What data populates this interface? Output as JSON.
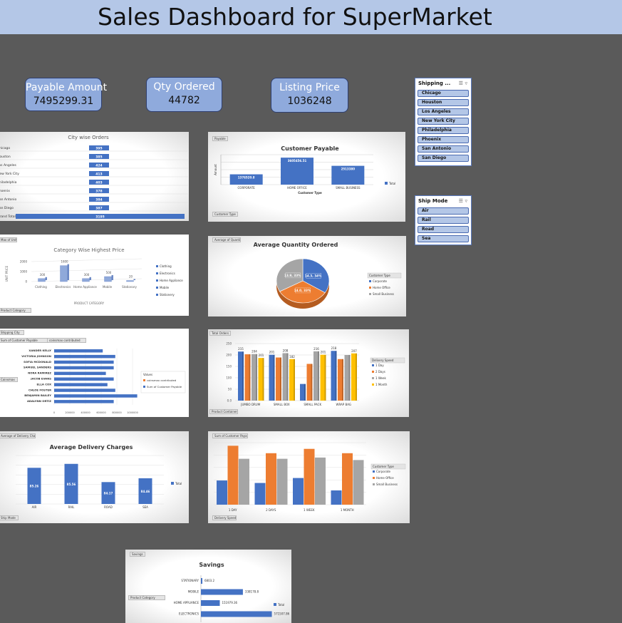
{
  "header": {
    "title": "Sales Dashboard for SuperMarket"
  },
  "kpis": [
    {
      "label": "Payable Amount",
      "value": "7495299.31"
    },
    {
      "label": "Qty Ordered",
      "value": "44782"
    },
    {
      "label": "Listing Price",
      "value": "1036248"
    }
  ],
  "slicers": [
    {
      "title": "Shipping ...",
      "items": [
        "Chicago",
        "Houston",
        "Los Angeles",
        "New York City",
        "Philadelphia",
        "Phoenix",
        "San Antonio",
        "San Diego"
      ]
    },
    {
      "title": "Ship Mode",
      "items": [
        "Air",
        "Rail",
        "Road",
        "Sea"
      ]
    }
  ],
  "colors": {
    "blue": "#4472c4",
    "orange": "#ed7d31",
    "gray": "#a5a5a5",
    "yellow": "#ffc000",
    "title_bar": "#b4c7e7",
    "kpi": "#8faadc",
    "background": "#5a5a5a"
  },
  "chart_data": [
    {
      "id": "city_orders",
      "type": "table",
      "title": "City wise Orders",
      "rows": [
        {
          "label": "Chicago",
          "value": 395
        },
        {
          "label": "Houston",
          "value": 385
        },
        {
          "label": "Los Angeles",
          "value": 424
        },
        {
          "label": "New York City",
          "value": 413
        },
        {
          "label": "Philadelphia",
          "value": 403
        },
        {
          "label": "Phoenix",
          "value": 378
        },
        {
          "label": "San Antonio",
          "value": 384
        },
        {
          "label": "San Diego",
          "value": 387
        },
        {
          "label": "Grand Total",
          "value": 3195
        }
      ]
    },
    {
      "id": "customer_payable",
      "type": "bar",
      "title": "Customer Payable",
      "categories": [
        "CORPORATE",
        "HOME OFFICE",
        "SMALL BUSINESS"
      ],
      "values": [
        1376520.8,
        3605456.51,
        2513380
      ],
      "value_labels": [
        "1376520.8",
        "3605456.51",
        "2513380"
      ],
      "xlabel": "Customer Type",
      "ylabel": "Amount",
      "ylim": [
        0,
        4000000
      ],
      "legend": "Total",
      "filter_top": "Payable",
      "filter_bottom": "Customer Type"
    },
    {
      "id": "category_price",
      "type": "bar",
      "title": "Category Wise Highest Price",
      "categories": [
        "Clothing",
        "Electronics",
        "Home Appliance",
        "Mobile",
        "Stationary"
      ],
      "values": [
        300,
        1600,
        300,
        500,
        20
      ],
      "value_labels": [
        "300",
        "1600",
        "300",
        "500",
        "20"
      ],
      "yticks": [
        "0",
        "1000",
        "2000"
      ],
      "ylim": [
        0,
        2000
      ],
      "xlabel": "PRODUCT CATEGORY",
      "ylabel": "UNIT PRICE",
      "legend_items": [
        "Clothing",
        "Electronics",
        "Home Appliance",
        "Mobile",
        "Stationery"
      ],
      "filter_top": "Max of Unit Price",
      "filter_bottom": "Product Category"
    },
    {
      "id": "avg_qty",
      "type": "pie",
      "title": "Average Quantity Ordered",
      "slices": [
        {
          "name": "Corporate",
          "value": 34,
          "label": "14.3, 34%"
        },
        {
          "name": "Home Office",
          "value": 33,
          "label": "14.0, 33%"
        },
        {
          "name": "Small Business",
          "value": 33,
          "label": "13.9, 33%"
        }
      ],
      "legend_title": "Customer Type",
      "filter_top": "Average of Quantity"
    },
    {
      "id": "customer_payable_hbar",
      "type": "bar",
      "title": "",
      "categories": [
        "XANDER KELLY",
        "VICTORIA JOHNSON",
        "SOFIA MCDONALD",
        "SAMUEL SANDERS",
        "NORA RAMIREZ",
        "JACOB EVANS",
        "ELLA COX",
        "CHLOE FOSTER",
        "BENJAMIN BAILEY",
        "ADALYNN ORTIZ"
      ],
      "series": [
        {
          "name": "coinsmax contributed",
          "values": [
            0,
            0,
            0,
            0,
            0,
            0,
            0,
            0,
            0,
            0
          ]
        },
        {
          "name": "Sum of Customer Payable",
          "values": [
            620000,
            780000,
            760000,
            760000,
            660000,
            760000,
            680000,
            780000,
            1060000,
            760000
          ]
        }
      ],
      "xticks": [
        "0",
        "200000",
        "400000",
        "600000",
        "800000",
        "1000000"
      ],
      "xlim": [
        0,
        1000000
      ],
      "legend_title": "Values",
      "filter_top": "Shipping City",
      "filter_a": "Sum of Customer Payable",
      "filter_b": "coinsmax contributed",
      "filter_side": "Coinsmax"
    },
    {
      "id": "total_orders",
      "type": "bar",
      "title": "",
      "categories": [
        "JUMBO DRUM",
        "SMALL BOX",
        "SMALL PACK",
        "WRAP BAG"
      ],
      "series": [
        {
          "name": "1 Day",
          "values": [
            215,
            201,
            73,
            218
          ]
        },
        {
          "name": "2 Days",
          "values": [
            203,
            189,
            161,
            182
          ]
        },
        {
          "name": "1 Week",
          "values": [
            204,
            208,
            216,
            200
          ]
        },
        {
          "name": "1 Month",
          "values": [
            187,
            182,
            201,
            207
          ]
        }
      ],
      "value_labels": [
        [
          "215",
          "201",
          "",
          "218"
        ],
        [
          "",
          "",
          "",
          ""
        ],
        [
          "204",
          "208",
          "216",
          ""
        ],
        [
          "201",
          "182",
          "201",
          "207"
        ]
      ],
      "yticks": [
        "0.0",
        "50",
        "100",
        "150",
        "200",
        "250"
      ],
      "ylim": [
        0,
        250
      ],
      "legend_title": "Delivery Speed",
      "filter_top": "Total Orders",
      "filter_bottom": "Product Container"
    },
    {
      "id": "delivery_charges",
      "type": "bar",
      "title": "Average Delivery Charges",
      "categories": [
        "AIR",
        "RAIL",
        "ROAD",
        "SEA"
      ],
      "values": [
        85.26,
        85.56,
        84.17,
        84.46
      ],
      "value_labels": [
        "85.26",
        "85.56",
        "84.17",
        "84.46"
      ],
      "ylim": [
        82.5,
        86.2
      ],
      "legend": "Total",
      "filter_top": "Average of Delivery Charges",
      "filter_bottom": "Ship Mode"
    },
    {
      "id": "speed_payable",
      "type": "bar",
      "title": "",
      "categories": [
        "1 DAY",
        "2 DAYS",
        "1 WEEK",
        "1 MONTH"
      ],
      "series": [
        {
          "name": "Corporate",
          "values": [
            390000,
            350000,
            430000,
            230000
          ]
        },
        {
          "name": "Home Office",
          "values": [
            950000,
            830000,
            900000,
            830000
          ]
        },
        {
          "name": "Small Business",
          "values": [
            740000,
            740000,
            760000,
            720000
          ]
        }
      ],
      "ylim": [
        0,
        1000000
      ],
      "legend_title": "Customer Type",
      "filter_top": "Sum of Customer Payable",
      "filter_bottom": "Delivery Speed"
    },
    {
      "id": "savings",
      "type": "bar",
      "title": "Savings",
      "categories": [
        "STATIONARY",
        "MOBILE",
        "HOME APPLIANCE",
        "ELECTRONICS"
      ],
      "values": [
        6803.2,
        338178.8,
        151979.36,
        571507.86
      ],
      "value_labels": [
        "6803.2",
        "338178.8",
        "151979.36",
        "571507.86"
      ],
      "xlim": [
        0,
        620000
      ],
      "legend": "Total",
      "filter_top": "Savings",
      "filter_side": "Product Category"
    }
  ]
}
